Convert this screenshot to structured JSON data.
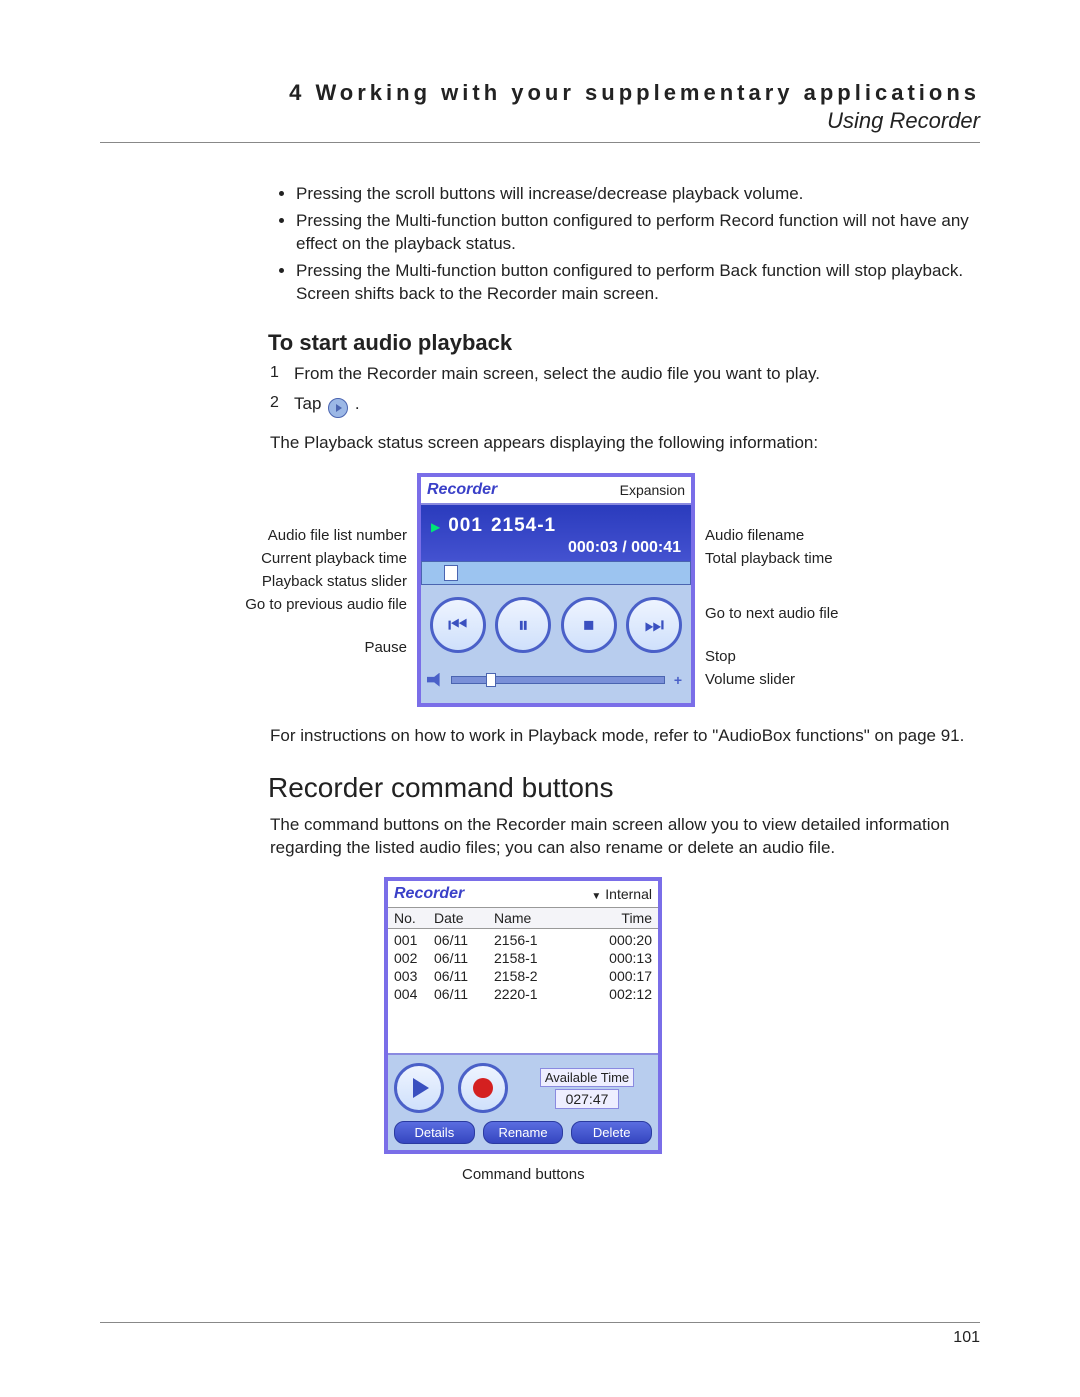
{
  "header": {
    "chapter": "4 Working with your supplementary applications",
    "section": "Using Recorder"
  },
  "bullets": [
    "Pressing the scroll buttons will increase/decrease playback volume.",
    "Pressing the Multi-function button configured to perform Record function will not have any effect on the playback status.",
    "Pressing the Multi-function button configured to perform Back function will stop playback. Screen shifts back to the Recorder main screen."
  ],
  "h3_start": "To start audio playback",
  "steps": {
    "s1": {
      "num": "1",
      "text": "From the Recorder main screen, select the audio file you want to play."
    },
    "s2": {
      "num": "2",
      "pre": "Tap ",
      "post": " ."
    }
  },
  "para_after_steps": "The Playback status screen appears displaying the following information:",
  "fig1": {
    "left_labels": [
      "Audio file list number",
      "Current playback time",
      "Playback status slider",
      "Go to previous audio file",
      "Pause"
    ],
    "right_labels": [
      "Audio filename",
      "Total playback time",
      "Go to next audio file",
      "Stop",
      "Volume slider"
    ],
    "app_title": "Recorder",
    "menu_right": "Expansion",
    "track_index": "001",
    "track_name": "2154-1",
    "time_cur": "000:03",
    "sep": " / ",
    "time_total": "000:41"
  },
  "para_ref": "For instructions on how to work in Playback mode, refer to \"AudioBox functions\" on page 91.",
  "h2_cmd": "Recorder command buttons",
  "para_cmd": "The command buttons on the Recorder main screen allow you to view detailed information regarding the listed audio files; you can also rename or delete an audio file.",
  "fig2": {
    "app_title": "Recorder",
    "menu_right": "Internal",
    "cols": {
      "no": "No.",
      "date": "Date",
      "name": "Name",
      "time": "Time"
    },
    "rows": [
      {
        "no": "001",
        "date": "06/11",
        "name": "2156-1",
        "time": "000:20"
      },
      {
        "no": "002",
        "date": "06/11",
        "name": "2158-1",
        "time": "000:13"
      },
      {
        "no": "003",
        "date": "06/11",
        "name": "2158-2",
        "time": "000:17"
      },
      {
        "no": "004",
        "date": "06/11",
        "name": "2220-1",
        "time": "002:12"
      }
    ],
    "available_label": "Available Time",
    "available_value": "027:47",
    "cmds": [
      "Details",
      "Rename",
      "Delete"
    ],
    "caption": "Command buttons"
  },
  "page_number": "101"
}
